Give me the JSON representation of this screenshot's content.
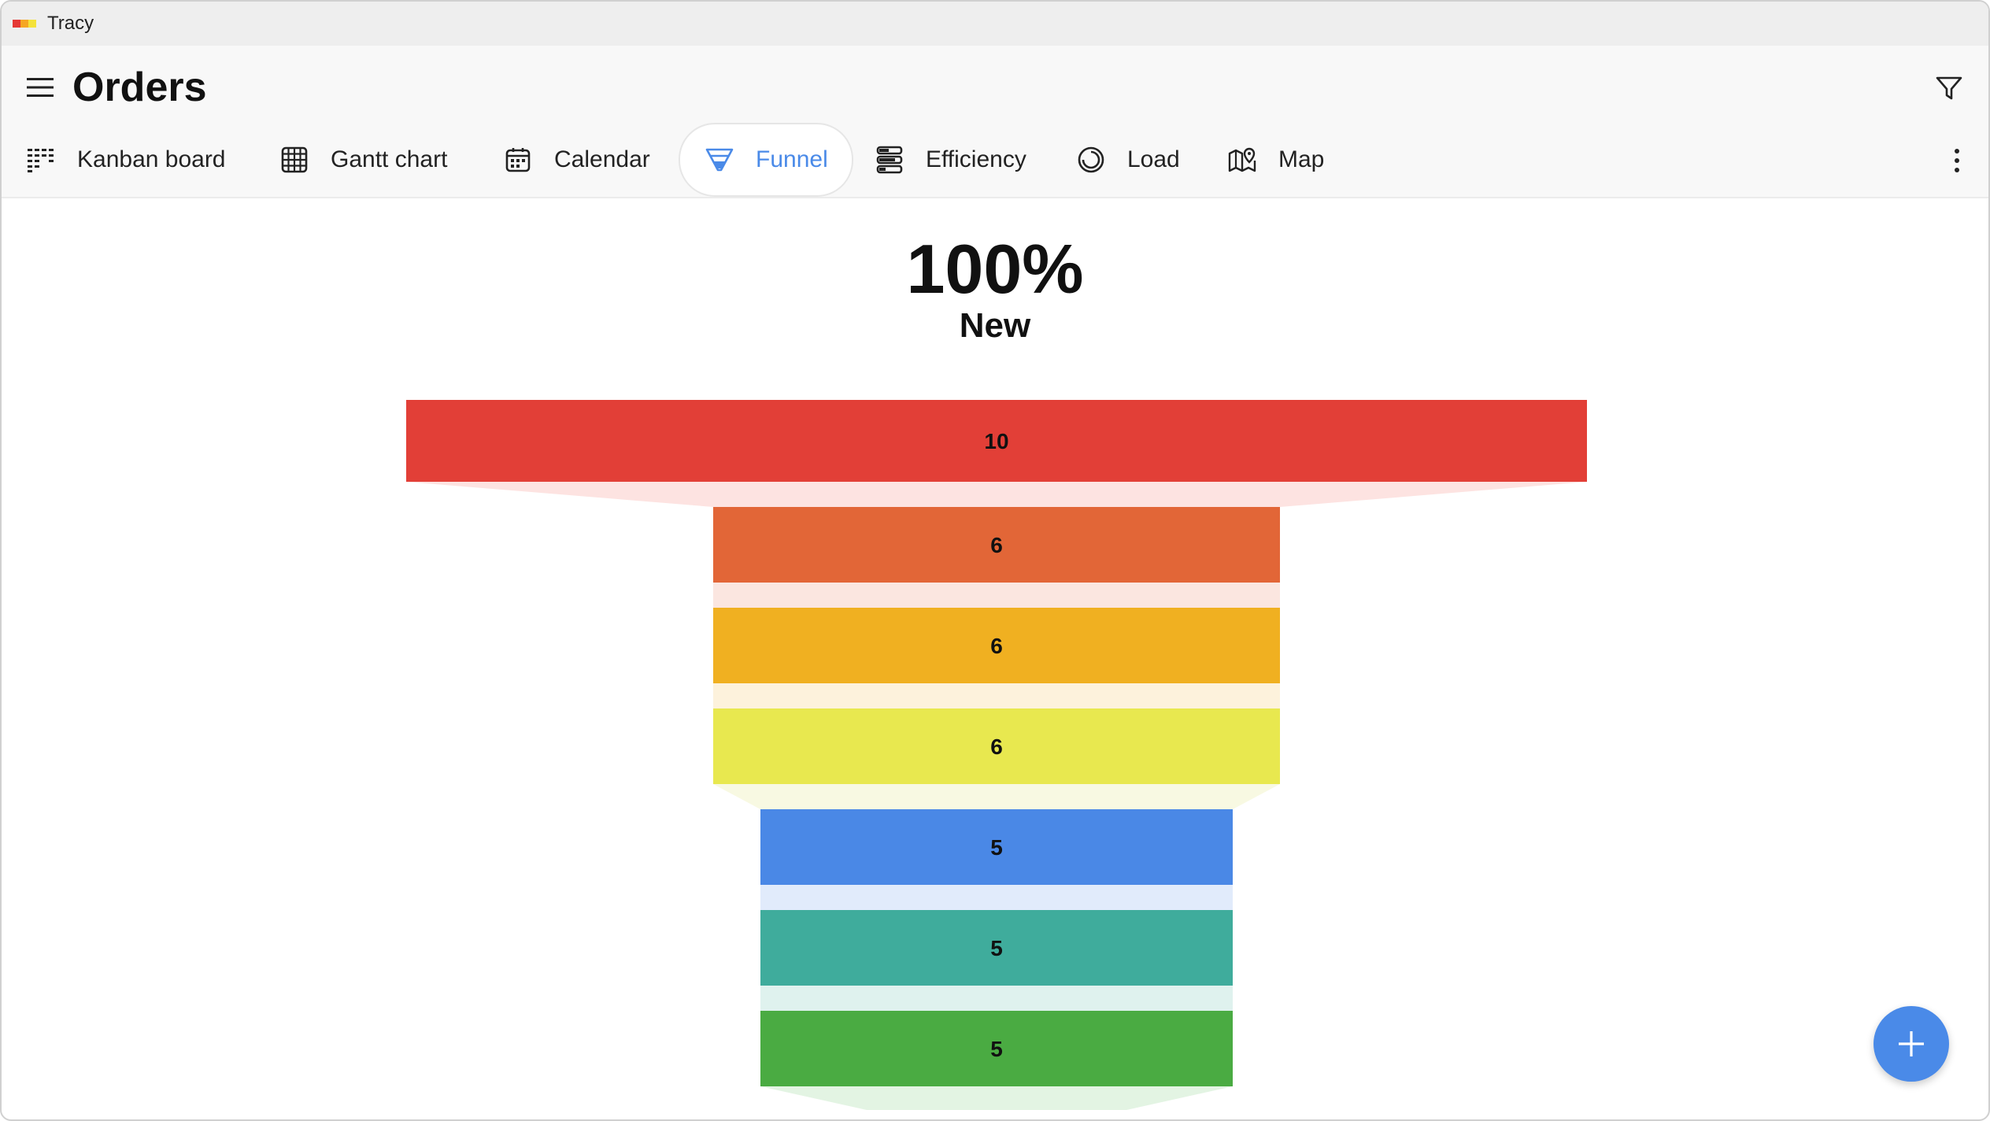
{
  "window": {
    "title": "Tracy",
    "logo_colors": [
      "#e53935",
      "#f5a623",
      "#f4e23a"
    ]
  },
  "header": {
    "title": "Orders",
    "tabs": [
      {
        "label": "Kanban board",
        "icon": "kanban-icon"
      },
      {
        "label": "Gantt chart",
        "icon": "gantt-icon"
      },
      {
        "label": "Calendar",
        "icon": "calendar-icon"
      },
      {
        "label": "Funnel",
        "icon": "funnel-icon",
        "active": true
      },
      {
        "label": "Efficiency",
        "icon": "efficiency-icon"
      },
      {
        "label": "Load",
        "icon": "load-icon"
      },
      {
        "label": "Map",
        "icon": "map-icon"
      }
    ],
    "accent_color": "#4a8ae8"
  },
  "summary": {
    "percent": "100%",
    "stage": "New"
  },
  "chart_data": {
    "type": "funnel",
    "values": [
      10,
      6,
      6,
      6,
      5,
      5,
      5
    ],
    "colors": [
      "#e23f37",
      "#e26637",
      "#f0b021",
      "#e8e84f",
      "#4a88e6",
      "#3fac9c",
      "#4aab42"
    ],
    "connector_colors": [
      "#fde3e1",
      "#fbe6e0",
      "#fdf2dc",
      "#f8f9e2",
      "#e1ebfb",
      "#dff2ee",
      "#e3f4e3"
    ]
  },
  "fab": {
    "icon": "plus-icon"
  }
}
